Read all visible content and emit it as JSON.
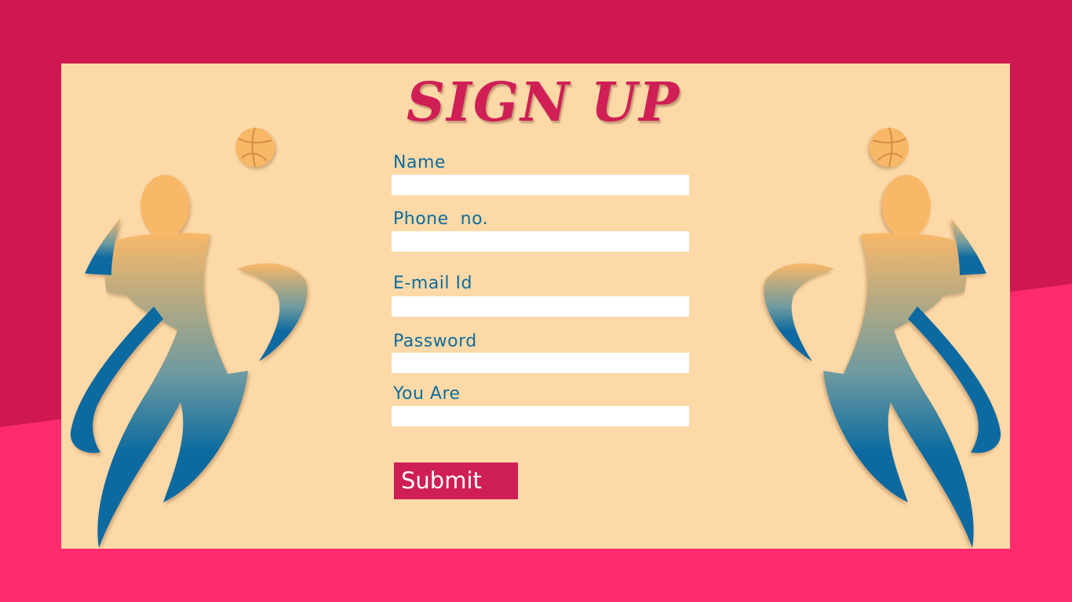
{
  "page": {
    "title": "SIGN UP"
  },
  "form": {
    "fields": [
      {
        "label": "Name",
        "value": ""
      },
      {
        "label": "Phone  no.",
        "value": ""
      },
      {
        "label": "E-mail Id",
        "value": ""
      },
      {
        "label": "Password",
        "value": ""
      },
      {
        "label": "You Are",
        "value": ""
      }
    ],
    "submit_label": "Submit"
  },
  "colors": {
    "background_top": "#cf1851",
    "background_bottom": "#ff2b6c",
    "card": "#fdd9a8",
    "title": "#cf1f55",
    "label": "#0f6c9c",
    "button": "#cf1f55",
    "ball": "#f9b868",
    "figure_top": "#f9b868",
    "figure_bottom": "#0a6aa0"
  },
  "icons": {
    "left_figure": "volleyball-player-icon",
    "right_figure": "volleyball-player-icon",
    "ball": "volleyball-icon"
  }
}
